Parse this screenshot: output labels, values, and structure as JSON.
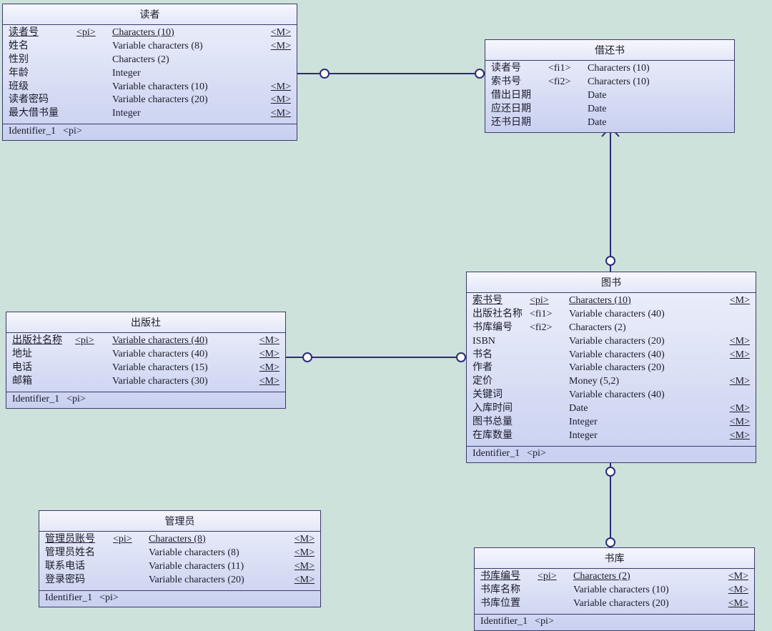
{
  "entities": {
    "reader": {
      "title": "读者",
      "attrs": [
        {
          "name": "读者号",
          "tag": "<pi>",
          "type": "Characters (10)",
          "m": "<M>",
          "pk": true
        },
        {
          "name": "姓名",
          "tag": "",
          "type": "Variable characters (8)",
          "m": "<M>"
        },
        {
          "name": "性别",
          "tag": "",
          "type": "Characters (2)",
          "m": ""
        },
        {
          "name": "年龄",
          "tag": "",
          "type": "Integer",
          "m": ""
        },
        {
          "name": "班级",
          "tag": "",
          "type": "Variable characters (10)",
          "m": "<M>"
        },
        {
          "name": "读者密码",
          "tag": "",
          "type": "Variable characters (20)",
          "m": "<M>"
        },
        {
          "name": "最大借书量",
          "tag": "",
          "type": "Integer",
          "m": "<M>"
        }
      ],
      "ident": {
        "name": "Identifier_1",
        "tag": "<pi>"
      }
    },
    "borrow": {
      "title": "借还书",
      "attrs": [
        {
          "name": "读者号",
          "tag": "<fi1>",
          "type": "Characters (10)",
          "m": ""
        },
        {
          "name": "索书号",
          "tag": "<fi2>",
          "type": "Characters (10)",
          "m": ""
        },
        {
          "name": "借出日期",
          "tag": "",
          "type": "Date",
          "m": ""
        },
        {
          "name": "应还日期",
          "tag": "",
          "type": "Date",
          "m": ""
        },
        {
          "name": "还书日期",
          "tag": "",
          "type": "Date",
          "m": ""
        }
      ]
    },
    "publisher": {
      "title": "出版社",
      "attrs": [
        {
          "name": "出版社名称",
          "tag": "<pi>",
          "type": "Variable characters (40)",
          "m": "<M>",
          "pk": true
        },
        {
          "name": "地址",
          "tag": "",
          "type": "Variable characters (40)",
          "m": "<M>"
        },
        {
          "name": "电话",
          "tag": "",
          "type": "Variable characters (15)",
          "m": "<M>"
        },
        {
          "name": "邮箱",
          "tag": "",
          "type": "Variable characters (30)",
          "m": "<M>"
        }
      ],
      "ident": {
        "name": "Identifier_1",
        "tag": "<pi>"
      }
    },
    "book": {
      "title": "图书",
      "attrs": [
        {
          "name": "索书号",
          "tag": "<pi>",
          "type": "Characters (10)",
          "m": "<M>",
          "pk": true
        },
        {
          "name": "出版社名称",
          "tag": "<fi1>",
          "type": "Variable characters (40)",
          "m": ""
        },
        {
          "name": "书库编号",
          "tag": "<fi2>",
          "type": "Characters (2)",
          "m": ""
        },
        {
          "name": "ISBN",
          "tag": "",
          "type": "Variable characters (20)",
          "m": "<M>"
        },
        {
          "name": "书名",
          "tag": "",
          "type": "Variable characters (40)",
          "m": "<M>"
        },
        {
          "name": "作者",
          "tag": "",
          "type": "Variable characters (20)",
          "m": ""
        },
        {
          "name": "定价",
          "tag": "",
          "type": "Money (5,2)",
          "m": "<M>"
        },
        {
          "name": "关键词",
          "tag": "",
          "type": "Variable characters (40)",
          "m": ""
        },
        {
          "name": "入库时间",
          "tag": "",
          "type": "Date",
          "m": "<M>"
        },
        {
          "name": "图书总量",
          "tag": "",
          "type": "Integer",
          "m": "<M>"
        },
        {
          "name": "在库数量",
          "tag": "",
          "type": "Integer",
          "m": "<M>"
        }
      ],
      "ident": {
        "name": "Identifier_1",
        "tag": "<pi>"
      }
    },
    "admin": {
      "title": "管理员",
      "attrs": [
        {
          "name": "管理员账号",
          "tag": "<pi>",
          "type": "Characters (8)",
          "m": "<M>",
          "pk": true
        },
        {
          "name": "管理员姓名",
          "tag": "",
          "type": "Variable characters (8)",
          "m": "<M>"
        },
        {
          "name": "联系电话",
          "tag": "",
          "type": "Variable characters (11)",
          "m": "<M>"
        },
        {
          "name": "登录密码",
          "tag": "",
          "type": "Variable characters (20)",
          "m": "<M>"
        }
      ],
      "ident": {
        "name": "Identifier_1",
        "tag": "<pi>"
      }
    },
    "stack": {
      "title": "书库",
      "attrs": [
        {
          "name": "书库编号",
          "tag": "<pi>",
          "type": "Characters (2)",
          "m": "<M>",
          "pk": true
        },
        {
          "name": "书库名称",
          "tag": "",
          "type": "Variable characters (10)",
          "m": "<M>"
        },
        {
          "name": "书库位置",
          "tag": "",
          "type": "Variable characters (20)",
          "m": "<M>"
        }
      ],
      "ident": {
        "name": "Identifier_1",
        "tag": "<pi>"
      }
    }
  },
  "relationships": [
    {
      "from": "reader",
      "to": "borrow",
      "type": "one-to-many"
    },
    {
      "from": "book",
      "to": "borrow",
      "type": "one-to-many"
    },
    {
      "from": "publisher",
      "to": "book",
      "type": "one-to-many"
    },
    {
      "from": "stack",
      "to": "book",
      "type": "one-to-many"
    }
  ]
}
